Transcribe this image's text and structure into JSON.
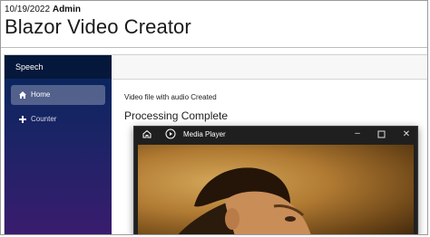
{
  "header": {
    "date": "10/19/2022",
    "user": "Admin"
  },
  "page_title": "Blazor Video Creator",
  "app": {
    "brand": "Speech",
    "nav": [
      {
        "label": "Home",
        "icon": "home-icon",
        "active": true
      },
      {
        "label": "Counter",
        "icon": "plus-icon",
        "active": false
      }
    ],
    "message": "Video file with audio Created",
    "heading": "Processing Complete"
  },
  "player": {
    "title": "Media Player",
    "icons": [
      "home-icon",
      "play-icon",
      "minimize-icon",
      "maximize-icon",
      "close-icon"
    ]
  },
  "colors": {
    "sidebar_top": "#05265a",
    "sidebar_bottom": "#3a1c6e",
    "player_chrome": "#1f1f1f",
    "video_tone": "#b07a32"
  }
}
